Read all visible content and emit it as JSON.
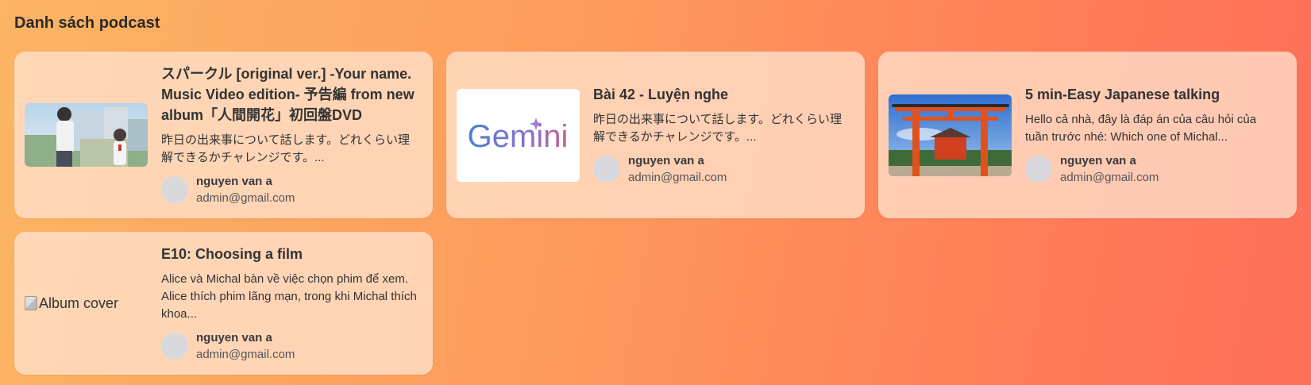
{
  "page": {
    "title": "Danh sách podcast"
  },
  "podcasts": [
    {
      "title": "スパークル [original ver.] -Your name. Music Video edition- 予告編 from new album「人間開花」初回盤DVD",
      "description": "昨日の出来事について話します。どれくらい理解できるかチャレンジです。...",
      "author_name": "nguyen van a",
      "author_email": "admin@gmail.com",
      "thumbnail": "anime-scene"
    },
    {
      "title": "Bài 42 - Luyện nghe",
      "description": "昨日の出来事について話します。どれくらい理解できるかチャレンジです。...",
      "author_name": "nguyen van a",
      "author_email": "admin@gmail.com",
      "thumbnail": "gemini-logo",
      "thumbnail_text": "Gemini"
    },
    {
      "title": "5 min-Easy Japanese talking",
      "description": "Hello cả nhà, đây là đáp án của câu hỏi của tuần trước nhé: Which one of Michal...",
      "author_name": "nguyen van a",
      "author_email": "admin@gmail.com",
      "thumbnail": "torii-gate"
    },
    {
      "title": "E10: Choosing a film",
      "description": "Alice và Michal bàn về việc chọn phim để xem. Alice thích phim lãng mạn, trong khi Michal thích khoa...",
      "author_name": "nguyen van a",
      "author_email": "admin@gmail.com",
      "thumbnail": "broken-image",
      "thumbnail_alt": "Album cover"
    }
  ]
}
